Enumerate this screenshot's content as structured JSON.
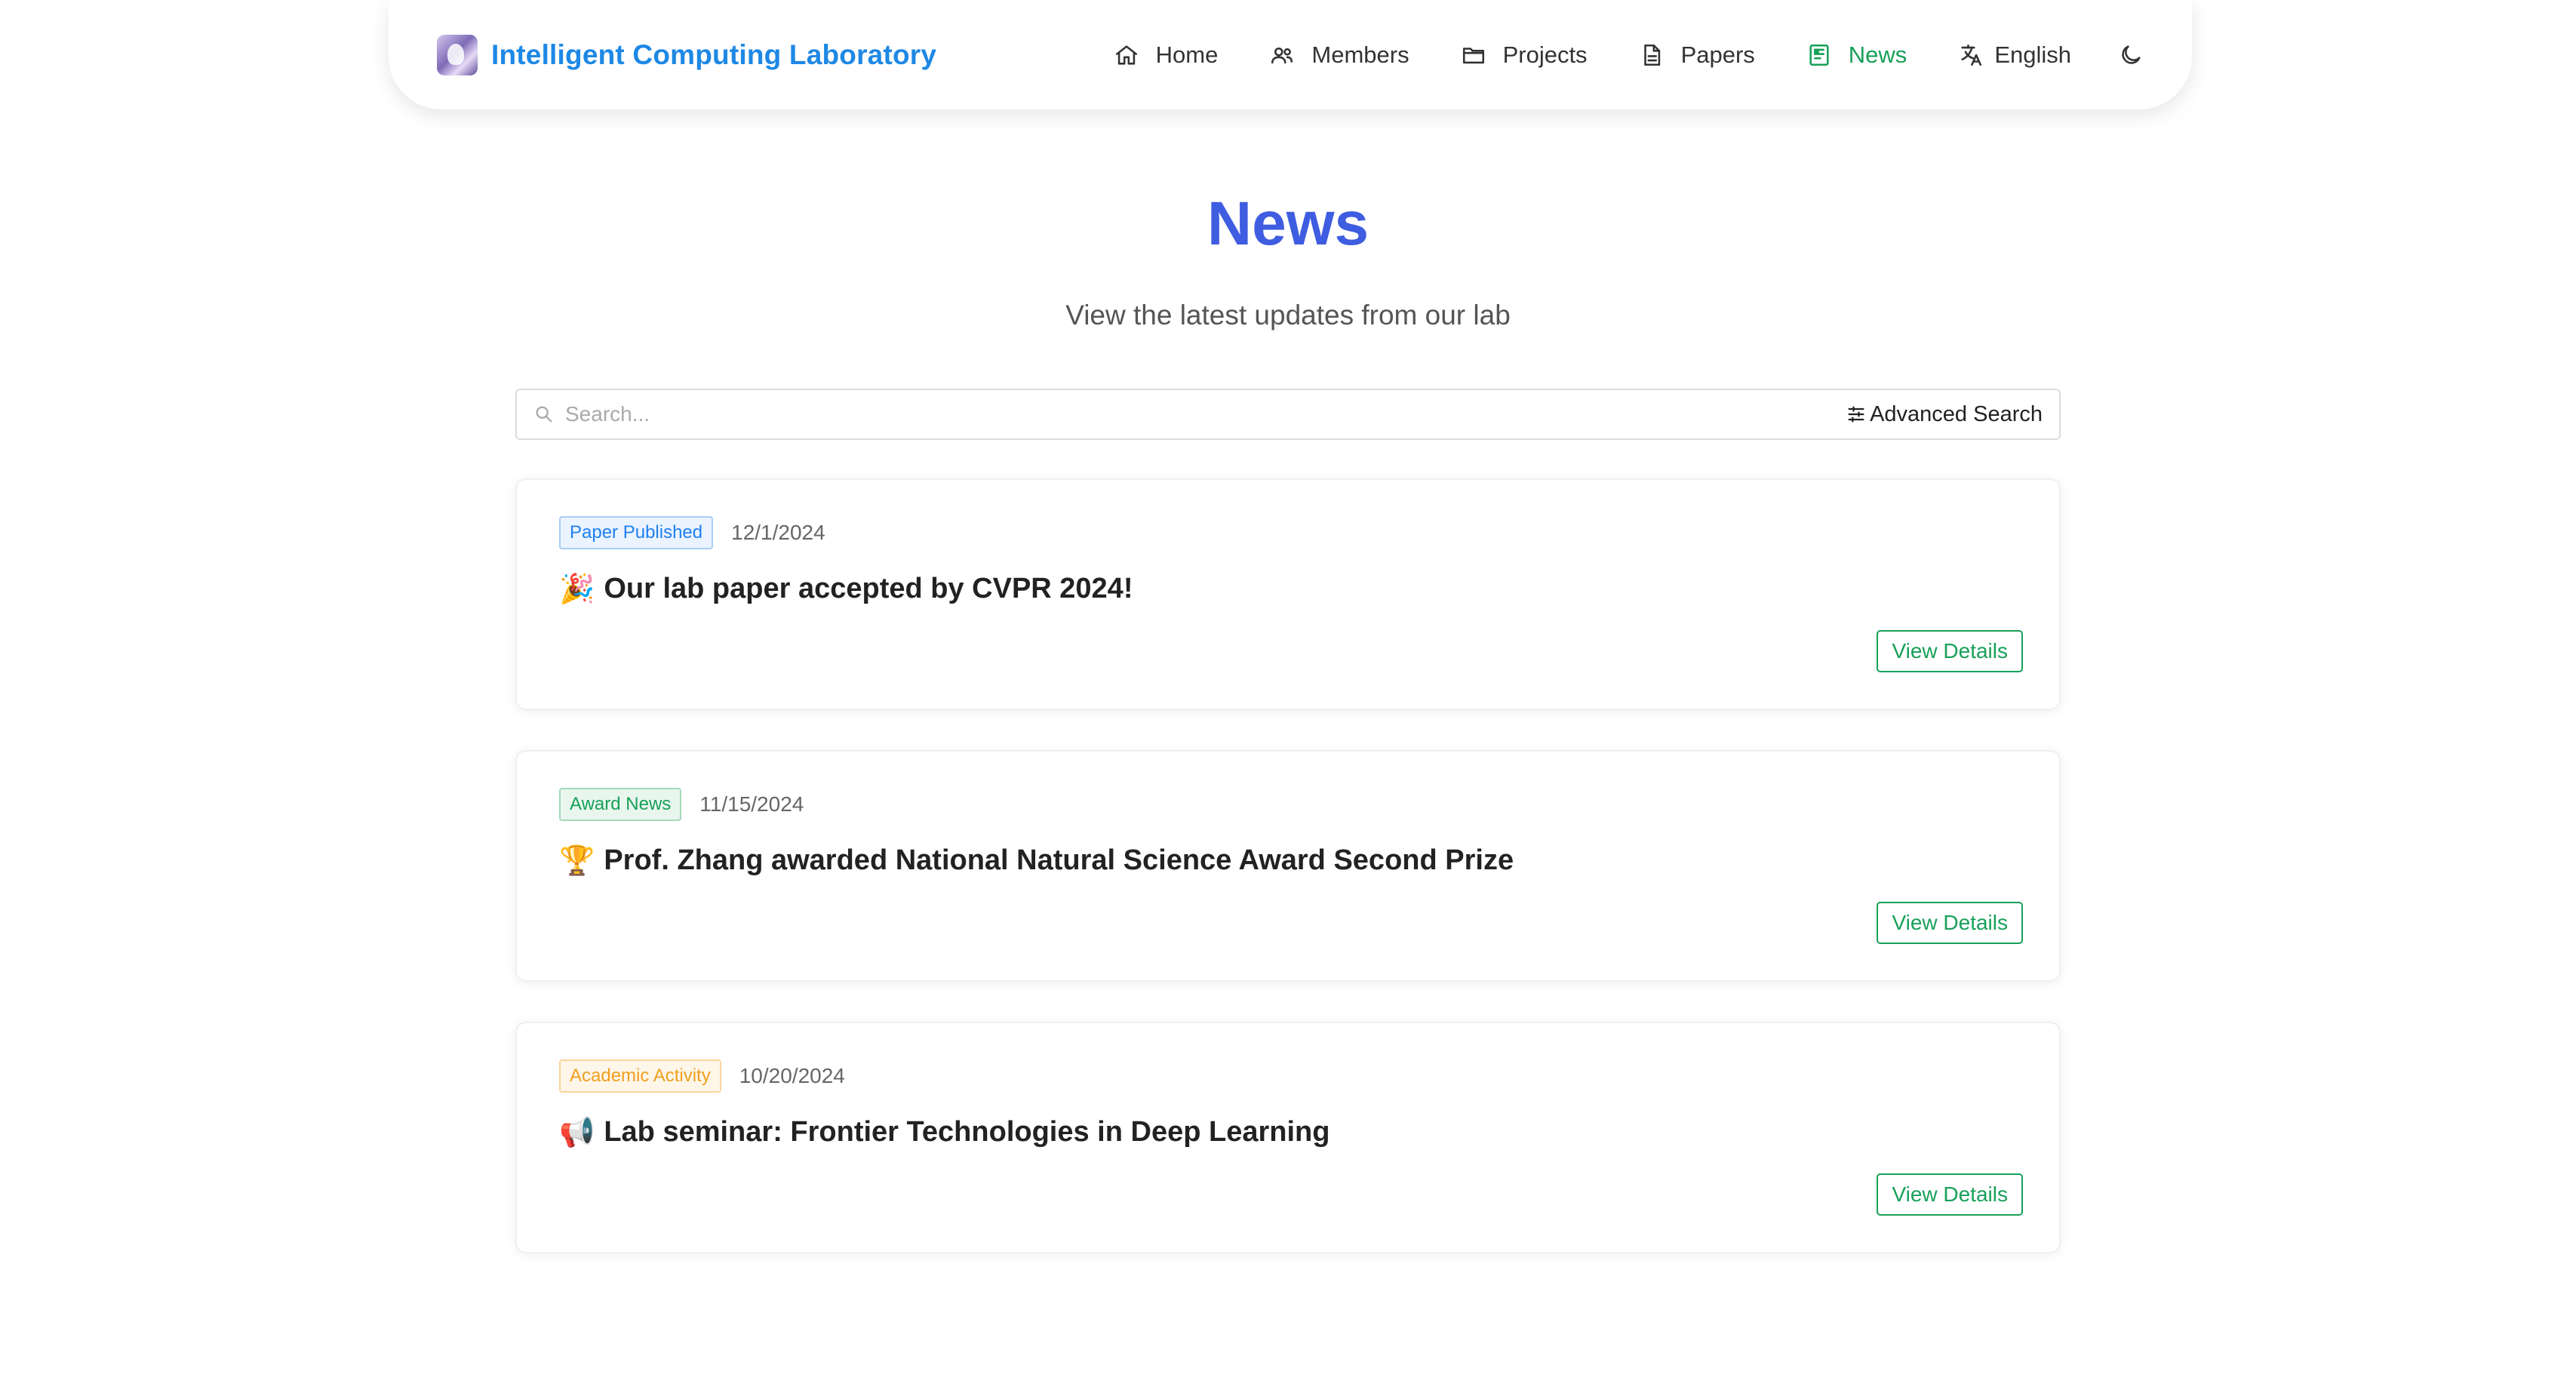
{
  "header": {
    "brand_name": "Intelligent Computing Laboratory",
    "logo_icon": "lab-logo",
    "nav": [
      {
        "label": "Home",
        "icon": "home-icon"
      },
      {
        "label": "Members",
        "icon": "members-icon"
      },
      {
        "label": "Projects",
        "icon": "folder-icon"
      },
      {
        "label": "Papers",
        "icon": "document-icon"
      },
      {
        "label": "News",
        "icon": "news-icon",
        "active": true
      }
    ],
    "language": "English",
    "theme_icon": "moon-icon"
  },
  "page": {
    "title": "News",
    "subtitle": "View the latest updates from our lab"
  },
  "search": {
    "placeholder": "Search...",
    "value": "",
    "advanced_label": "Advanced Search"
  },
  "news": [
    {
      "tag": "Paper Published",
      "tag_color": "#2080f0",
      "date": "12/1/2024",
      "emoji": "🎉",
      "title": "Our lab paper accepted by CVPR 2024!",
      "button": "View Details"
    },
    {
      "tag": "Award News",
      "tag_color": "#18a058",
      "date": "11/15/2024",
      "emoji": "🏆",
      "title": "Prof. Zhang awarded National Natural Science Award Second Prize",
      "button": "View Details"
    },
    {
      "tag": "Academic Activity",
      "tag_color": "#f0a020",
      "date": "10/20/2024",
      "emoji": "📢",
      "title": "Lab seminar: Frontier Technologies in Deep Learning",
      "button": "View Details"
    }
  ],
  "colors": {
    "brand": "#1e88e5",
    "title": "#3f5de0",
    "accent": "#18a058"
  }
}
